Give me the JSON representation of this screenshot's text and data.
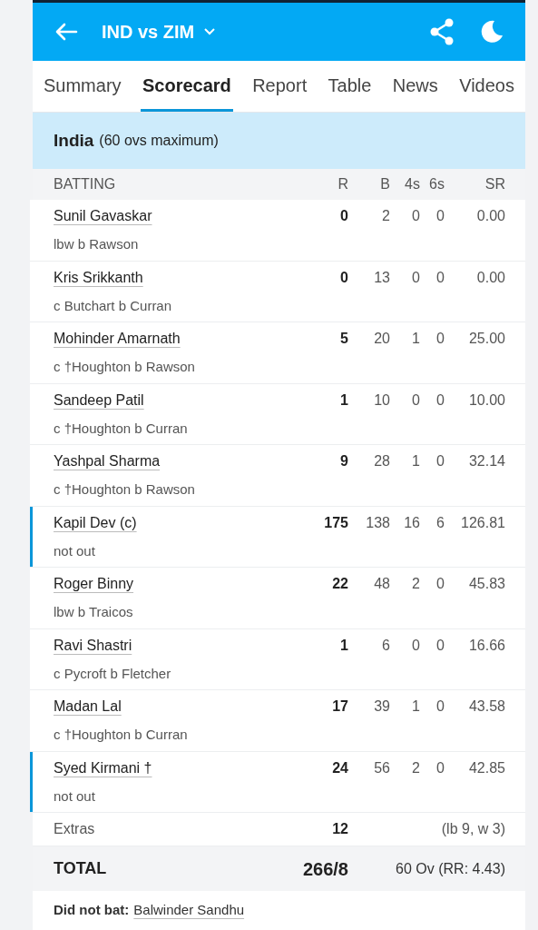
{
  "header": {
    "title": "IND vs ZIM"
  },
  "tabs": [
    {
      "label": "Summary",
      "selected": false
    },
    {
      "label": "Scorecard",
      "selected": true
    },
    {
      "label": "Report",
      "selected": false
    },
    {
      "label": "Table",
      "selected": false
    },
    {
      "label": "News",
      "selected": false
    },
    {
      "label": "Videos",
      "selected": false
    }
  ],
  "innings": {
    "team": "India",
    "note": "(60 ovs maximum)"
  },
  "columns": [
    "BATTING",
    "R",
    "B",
    "4s",
    "6s",
    "SR"
  ],
  "batters": [
    {
      "name": "Sunil Gavaskar",
      "dismissal": "lbw b Rawson",
      "r": "0",
      "b": "2",
      "fours": "0",
      "sixes": "0",
      "sr": "0.00",
      "highlighted": false
    },
    {
      "name": "Kris Srikkanth",
      "dismissal": "c Butchart b Curran",
      "r": "0",
      "b": "13",
      "fours": "0",
      "sixes": "0",
      "sr": "0.00",
      "highlighted": false
    },
    {
      "name": "Mohinder Amarnath",
      "dismissal": "c †Houghton b Rawson",
      "r": "5",
      "b": "20",
      "fours": "1",
      "sixes": "0",
      "sr": "25.00",
      "highlighted": false
    },
    {
      "name": "Sandeep Patil",
      "dismissal": "c †Houghton b Curran",
      "r": "1",
      "b": "10",
      "fours": "0",
      "sixes": "0",
      "sr": "10.00",
      "highlighted": false
    },
    {
      "name": "Yashpal Sharma",
      "dismissal": "c †Houghton b Rawson",
      "r": "9",
      "b": "28",
      "fours": "1",
      "sixes": "0",
      "sr": "32.14",
      "highlighted": false
    },
    {
      "name": "Kapil Dev (c)",
      "dismissal": "not out",
      "r": "175",
      "b": "138",
      "fours": "16",
      "sixes": "6",
      "sr": "126.81",
      "highlighted": true
    },
    {
      "name": "Roger Binny",
      "dismissal": "lbw b Traicos",
      "r": "22",
      "b": "48",
      "fours": "2",
      "sixes": "0",
      "sr": "45.83",
      "highlighted": false
    },
    {
      "name": "Ravi Shastri",
      "dismissal": "c Pycroft b Fletcher",
      "r": "1",
      "b": "6",
      "fours": "0",
      "sixes": "0",
      "sr": "16.66",
      "highlighted": false
    },
    {
      "name": "Madan Lal",
      "dismissal": "c †Houghton b Curran",
      "r": "17",
      "b": "39",
      "fours": "1",
      "sixes": "0",
      "sr": "43.58",
      "highlighted": false
    },
    {
      "name": "Syed Kirmani †",
      "dismissal": "not out",
      "r": "24",
      "b": "56",
      "fours": "2",
      "sixes": "0",
      "sr": "42.85",
      "highlighted": true
    }
  ],
  "extras": {
    "label": "Extras",
    "runs": "12",
    "detail": "(lb 9, w 3)"
  },
  "total": {
    "label": "TOTAL",
    "runs": "266/8",
    "detail": "60 Ov (RR: 4.43)"
  },
  "did_not_bat": {
    "label": "Did not bat:",
    "players": [
      "Balwinder Sandhu"
    ]
  }
}
